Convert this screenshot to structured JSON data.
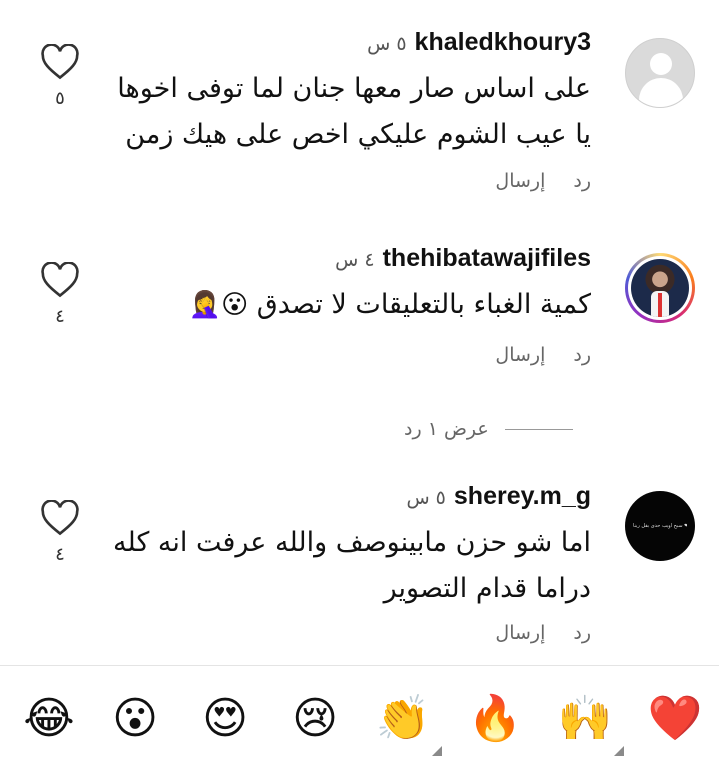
{
  "comments": [
    {
      "username": "khaledkhoury3",
      "time": "٥ س",
      "lines": [
        "على اساس  صار معها جنان لما توفى اخوها",
        "يا عيب الشوم عليكي اخص على هيك زمن"
      ],
      "emoji": "",
      "reply_label": "رد",
      "send_label": "إرسال",
      "like_count": "٥"
    },
    {
      "username": "thehibatawajifiles",
      "time": "٤ س",
      "lines": [
        "كمية الغباء بالتعليقات لا تصدق"
      ],
      "emoji": "😮🤦‍♀️",
      "reply_label": "رد",
      "send_label": "إرسال",
      "like_count": "٤"
    },
    {
      "username": "sherey.m_g",
      "time": "٥ س",
      "lines": [
        "اما شو حزن مابينوصف والله عرفت انه كله",
        "دراما قدام التصوير"
      ],
      "emoji": "",
      "reply_label": "رد",
      "send_label": "إرسال",
      "like_count": "٤",
      "avatar_text": "سبح اويب حدى بقل ربنا ❤"
    }
  ],
  "view_replies_label": "عرض ١ رد",
  "emoji_bar": [
    {
      "emoji": "😂",
      "name": "tears-of-joy-emoji"
    },
    {
      "emoji": "😮",
      "name": "open-mouth-emoji"
    },
    {
      "emoji": "😍",
      "name": "heart-eyes-emoji"
    },
    {
      "emoji": "😢",
      "name": "crying-emoji"
    },
    {
      "emoji": "👏",
      "name": "clapping-emoji"
    },
    {
      "emoji": "🔥",
      "name": "fire-emoji"
    },
    {
      "emoji": "🙌",
      "name": "raised-hands-emoji"
    },
    {
      "emoji": "❤️",
      "name": "red-heart-emoji"
    }
  ],
  "icons": {
    "like": "heart-outline-icon"
  },
  "colors": {
    "text": "#111111",
    "muted": "#666666",
    "heart_outline": "#333333"
  }
}
